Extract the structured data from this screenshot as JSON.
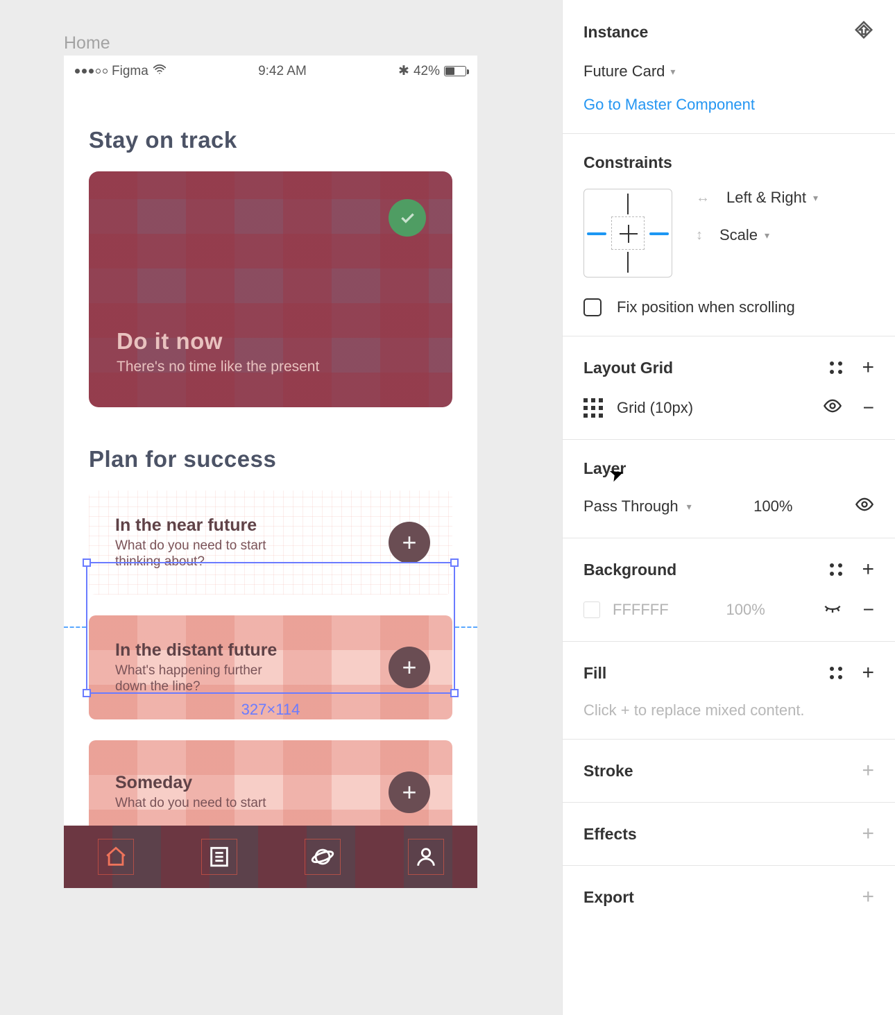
{
  "canvas": {
    "frame_label": "Home",
    "status_bar": {
      "carrier": "Figma",
      "time": "9:42 AM",
      "battery": "42%",
      "bluetooth_glyph": "✱"
    },
    "section1_title": "Stay on track",
    "hero": {
      "title": "Do it now",
      "subtitle": "There's no time like the present"
    },
    "section2_title": "Plan for success",
    "cards": [
      {
        "title": "In the near future",
        "subtitle": "What do you need to start thinking about?"
      },
      {
        "title": "In the distant future",
        "subtitle": "What's happening further down the line?"
      },
      {
        "title": "Someday",
        "subtitle": "What do you need to start"
      }
    ],
    "selection_dimensions": "327×114"
  },
  "inspector": {
    "instance": {
      "header": "Instance",
      "name": "Future Card",
      "master_link": "Go to Master Component"
    },
    "constraints": {
      "header": "Constraints",
      "horizontal": "Left & Right",
      "vertical": "Scale",
      "fix_position_label": "Fix position when scrolling"
    },
    "layout_grid": {
      "header": "Layout Grid",
      "item": "Grid (10px)"
    },
    "layer": {
      "header": "Layer",
      "blend_mode": "Pass Through",
      "opacity": "100%"
    },
    "background": {
      "header": "Background",
      "hex": "FFFFFF",
      "opacity": "100%"
    },
    "fill": {
      "header": "Fill",
      "hint": "Click + to replace mixed content."
    },
    "stroke": {
      "header": "Stroke"
    },
    "effects": {
      "header": "Effects"
    },
    "export": {
      "header": "Export"
    }
  }
}
